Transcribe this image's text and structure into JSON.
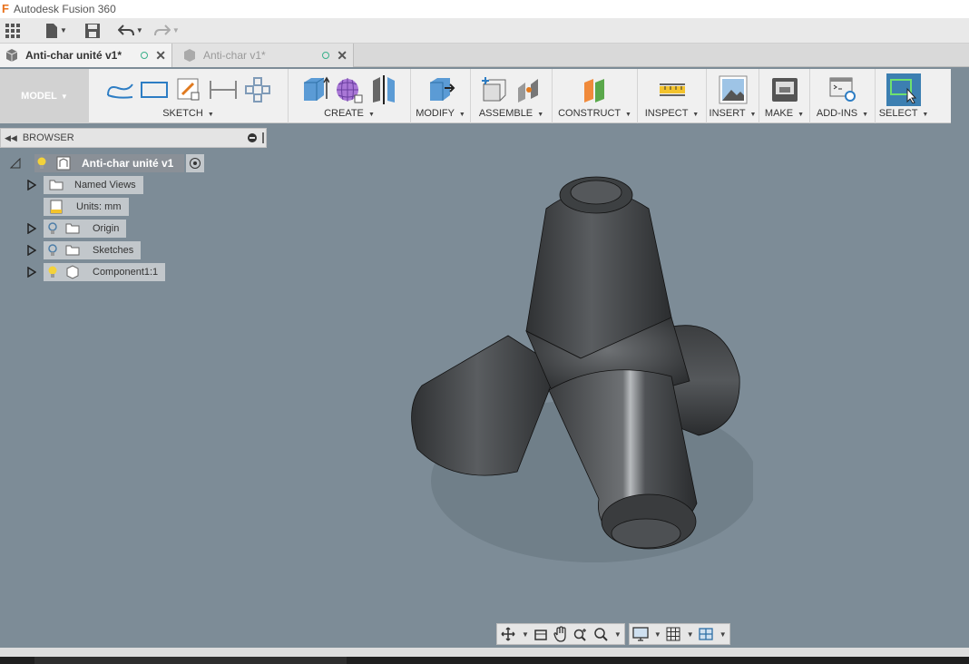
{
  "window": {
    "title": "Autodesk Fusion 360"
  },
  "tabs": [
    {
      "label": "Anti-char unité v1*",
      "active": true
    },
    {
      "label": "Anti-char v1*",
      "active": false
    }
  ],
  "toolbar": {
    "workspace": "MODEL",
    "groups": [
      {
        "label": "SKETCH"
      },
      {
        "label": "CREATE"
      },
      {
        "label": "MODIFY"
      },
      {
        "label": "ASSEMBLE"
      },
      {
        "label": "CONSTRUCT"
      },
      {
        "label": "INSPECT"
      },
      {
        "label": "INSERT"
      },
      {
        "label": "MAKE"
      },
      {
        "label": "ADD-INS"
      },
      {
        "label": "SELECT"
      }
    ]
  },
  "browser": {
    "title": "BROWSER",
    "root": "Anti-char unité v1",
    "items": [
      {
        "label": "Named Views"
      },
      {
        "label": "Units: mm"
      },
      {
        "label": "Origin"
      },
      {
        "label": "Sketches"
      },
      {
        "label": "Component1:1"
      }
    ]
  },
  "colors": {
    "accent": "#3c7fb1",
    "viewport": "#7d8c97",
    "model": "#4a4d4f"
  }
}
